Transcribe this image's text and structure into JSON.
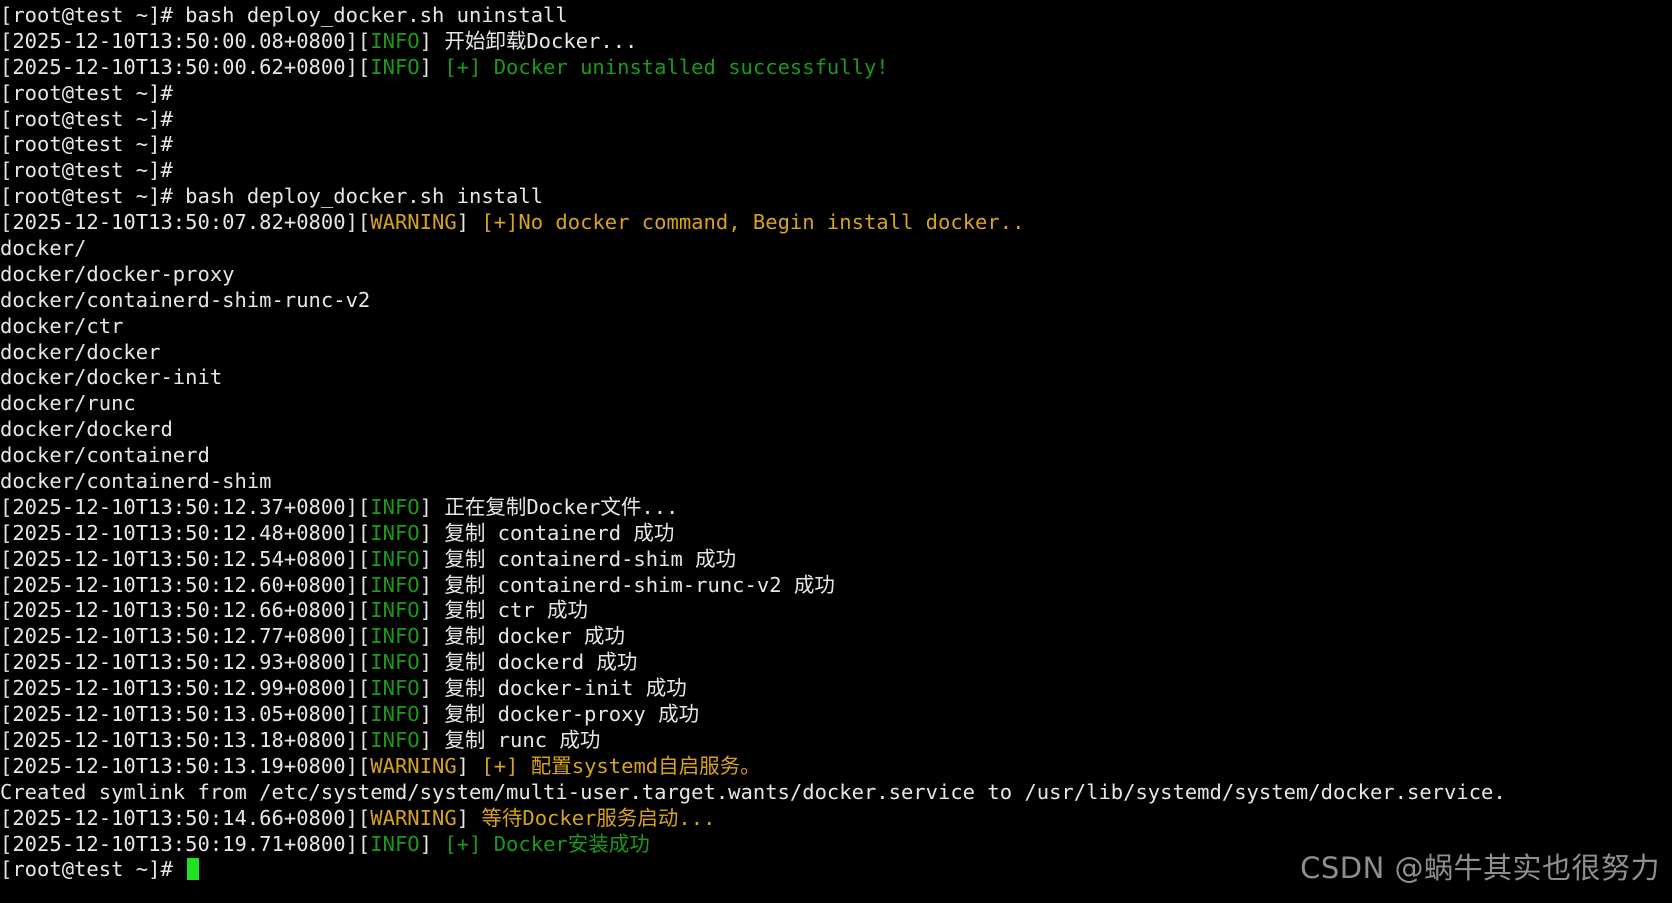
{
  "terminal": {
    "lines": [
      [
        {
          "t": "[root@test ~]# bash deploy_docker.sh uninstall",
          "c": "default"
        }
      ],
      [
        {
          "t": "[2025-12-10T13:50:00.08+0800][",
          "c": "default"
        },
        {
          "t": "INFO",
          "c": "info"
        },
        {
          "t": "] 开始卸载Docker...",
          "c": "default"
        }
      ],
      [
        {
          "t": "[2025-12-10T13:50:00.62+0800][",
          "c": "default"
        },
        {
          "t": "INFO",
          "c": "info"
        },
        {
          "t": "] ",
          "c": "default"
        },
        {
          "t": "[+] Docker uninstalled successfully!",
          "c": "green"
        }
      ],
      [
        {
          "t": "[root@test ~]#",
          "c": "default"
        }
      ],
      [
        {
          "t": "[root@test ~]#",
          "c": "default"
        }
      ],
      [
        {
          "t": "[root@test ~]#",
          "c": "default"
        }
      ],
      [
        {
          "t": "[root@test ~]#",
          "c": "default"
        }
      ],
      [
        {
          "t": "[root@test ~]# bash deploy_docker.sh install",
          "c": "default"
        }
      ],
      [
        {
          "t": "[2025-12-10T13:50:07.82+0800][",
          "c": "default"
        },
        {
          "t": "WARNING",
          "c": "warn"
        },
        {
          "t": "] ",
          "c": "default"
        },
        {
          "t": "[+]No docker command, Begin install docker..",
          "c": "warn"
        }
      ],
      [
        {
          "t": "docker/",
          "c": "default"
        }
      ],
      [
        {
          "t": "docker/docker-proxy",
          "c": "default"
        }
      ],
      [
        {
          "t": "docker/containerd-shim-runc-v2",
          "c": "default"
        }
      ],
      [
        {
          "t": "docker/ctr",
          "c": "default"
        }
      ],
      [
        {
          "t": "docker/docker",
          "c": "default"
        }
      ],
      [
        {
          "t": "docker/docker-init",
          "c": "default"
        }
      ],
      [
        {
          "t": "docker/runc",
          "c": "default"
        }
      ],
      [
        {
          "t": "docker/dockerd",
          "c": "default"
        }
      ],
      [
        {
          "t": "docker/containerd",
          "c": "default"
        }
      ],
      [
        {
          "t": "docker/containerd-shim",
          "c": "default"
        }
      ],
      [
        {
          "t": "[2025-12-10T13:50:12.37+0800][",
          "c": "default"
        },
        {
          "t": "INFO",
          "c": "info"
        },
        {
          "t": "] 正在复制Docker文件...",
          "c": "default"
        }
      ],
      [
        {
          "t": "[2025-12-10T13:50:12.48+0800][",
          "c": "default"
        },
        {
          "t": "INFO",
          "c": "info"
        },
        {
          "t": "] 复制 containerd 成功",
          "c": "default"
        }
      ],
      [
        {
          "t": "[2025-12-10T13:50:12.54+0800][",
          "c": "default"
        },
        {
          "t": "INFO",
          "c": "info"
        },
        {
          "t": "] 复制 containerd-shim 成功",
          "c": "default"
        }
      ],
      [
        {
          "t": "[2025-12-10T13:50:12.60+0800][",
          "c": "default"
        },
        {
          "t": "INFO",
          "c": "info"
        },
        {
          "t": "] 复制 containerd-shim-runc-v2 成功",
          "c": "default"
        }
      ],
      [
        {
          "t": "[2025-12-10T13:50:12.66+0800][",
          "c": "default"
        },
        {
          "t": "INFO",
          "c": "info"
        },
        {
          "t": "] 复制 ctr 成功",
          "c": "default"
        }
      ],
      [
        {
          "t": "[2025-12-10T13:50:12.77+0800][",
          "c": "default"
        },
        {
          "t": "INFO",
          "c": "info"
        },
        {
          "t": "] 复制 docker 成功",
          "c": "default"
        }
      ],
      [
        {
          "t": "[2025-12-10T13:50:12.93+0800][",
          "c": "default"
        },
        {
          "t": "INFO",
          "c": "info"
        },
        {
          "t": "] 复制 dockerd 成功",
          "c": "default"
        }
      ],
      [
        {
          "t": "[2025-12-10T13:50:12.99+0800][",
          "c": "default"
        },
        {
          "t": "INFO",
          "c": "info"
        },
        {
          "t": "] 复制 docker-init 成功",
          "c": "default"
        }
      ],
      [
        {
          "t": "[2025-12-10T13:50:13.05+0800][",
          "c": "default"
        },
        {
          "t": "INFO",
          "c": "info"
        },
        {
          "t": "] 复制 docker-proxy 成功",
          "c": "default"
        }
      ],
      [
        {
          "t": "[2025-12-10T13:50:13.18+0800][",
          "c": "default"
        },
        {
          "t": "INFO",
          "c": "info"
        },
        {
          "t": "] 复制 runc 成功",
          "c": "default"
        }
      ],
      [
        {
          "t": "[2025-12-10T13:50:13.19+0800][",
          "c": "default"
        },
        {
          "t": "WARNING",
          "c": "warn"
        },
        {
          "t": "] ",
          "c": "default"
        },
        {
          "t": "[+] 配置systemd自启服务。",
          "c": "warn"
        }
      ],
      [
        {
          "t": "Created symlink from /etc/systemd/system/multi-user.target.wants/docker.service to /usr/lib/systemd/system/docker.service.",
          "c": "default"
        }
      ],
      [
        {
          "t": "[2025-12-10T13:50:14.66+0800][",
          "c": "default"
        },
        {
          "t": "WARNING",
          "c": "warn"
        },
        {
          "t": "] ",
          "c": "default"
        },
        {
          "t": "等待Docker服务启动...",
          "c": "warn"
        }
      ],
      [
        {
          "t": "[2025-12-10T13:50:19.71+0800][",
          "c": "default"
        },
        {
          "t": "INFO",
          "c": "info"
        },
        {
          "t": "] ",
          "c": "default"
        },
        {
          "t": "[+] Docker安装成功",
          "c": "green"
        }
      ]
    ],
    "prompt": "[root@test ~]# "
  },
  "watermark": "CSDN @蜗牛其实也很努力",
  "colors": {
    "background": "#000000",
    "text": "#e6e6e6",
    "info": "#1a9a1a",
    "warning": "#d7a21d",
    "cursor": "#22e022"
  }
}
